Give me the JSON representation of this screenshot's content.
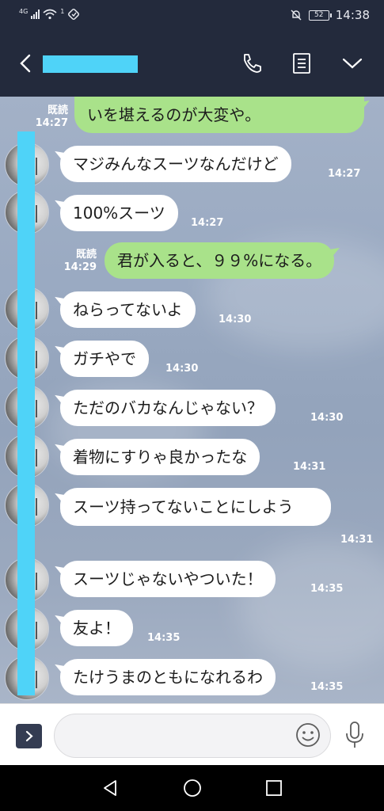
{
  "status_bar": {
    "network": "4G",
    "signal_badge": "1",
    "battery": "52",
    "time": "14:38"
  },
  "header": {
    "back_icon": "chevron-left-icon",
    "phone_icon": "phone-icon",
    "notes_icon": "note-icon",
    "menu_icon": "chevron-down-icon"
  },
  "messages": [
    {
      "side": "out",
      "text": "いを堪えるのが大変や。",
      "time": "14:27",
      "read": "既読"
    },
    {
      "side": "in",
      "text": "マジみんなスーツなんだけど",
      "time": "14:27"
    },
    {
      "side": "in",
      "text": "100%スーツ",
      "time": "14:27"
    },
    {
      "side": "out",
      "text": "君が入ると、９９%になる。",
      "time": "14:29",
      "read": "既読"
    },
    {
      "side": "in",
      "text": "ねらってないよ",
      "time": "14:30"
    },
    {
      "side": "in",
      "text": "ガチやで",
      "time": "14:30"
    },
    {
      "side": "in",
      "text": "ただのバカなんじゃない？",
      "time": "14:30"
    },
    {
      "side": "in",
      "text": "着物にすりゃ良かったな",
      "time": "14:31"
    },
    {
      "side": "in",
      "text": "スーツ持ってないことにしよう",
      "time": "14:31"
    },
    {
      "side": "in",
      "text": "スーツじゃないやついた！",
      "time": "14:35"
    },
    {
      "side": "in",
      "text": "友よ！",
      "time": "14:35"
    },
    {
      "side": "in",
      "text": "たけうまのともになれるわ",
      "time": "14:35"
    }
  ],
  "input": {
    "placeholder": "",
    "expand_icon": "chevron-right-icon",
    "emoji_icon": "smiley-icon",
    "mic_icon": "microphone-icon"
  },
  "navigation": {
    "back": "back-triangle-icon",
    "home": "home-circle-icon",
    "recents": "recents-square-icon"
  },
  "colors": {
    "header": "#232a3c",
    "outgoing_bubble": "#a9e28a",
    "incoming_bubble": "#ffffff",
    "redaction": "#4fd3f8"
  }
}
